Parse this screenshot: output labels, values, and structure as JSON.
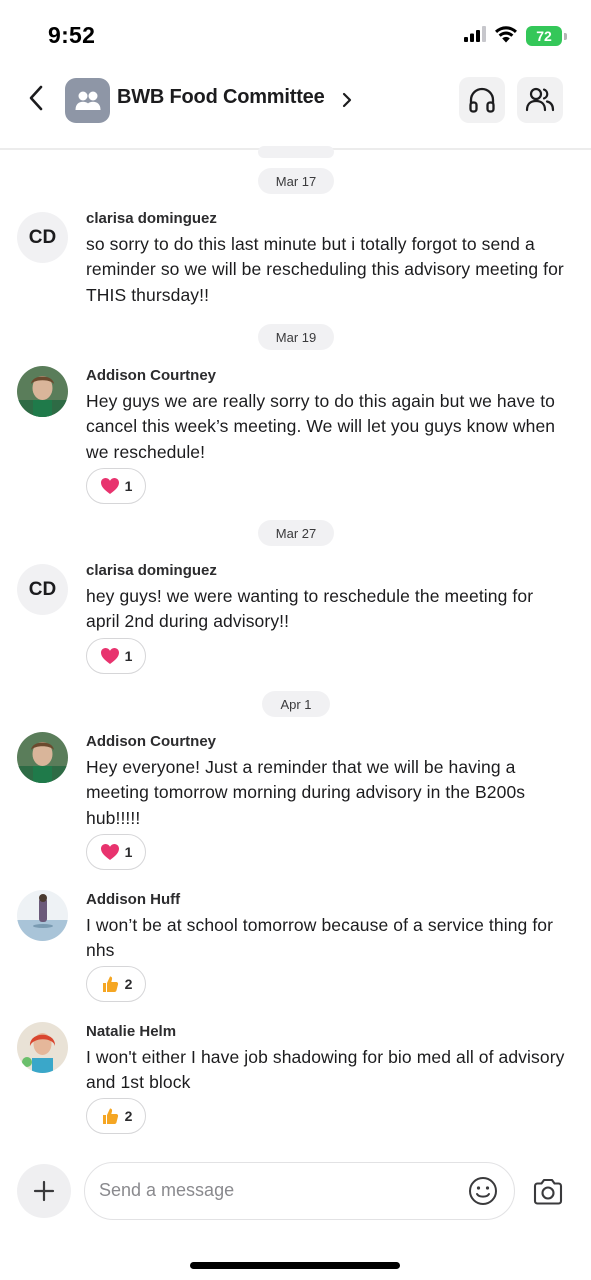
{
  "status_bar": {
    "time": "9:52",
    "battery": "72"
  },
  "header": {
    "group_name": "BWB Food Committee"
  },
  "messages": [
    {
      "type": "date",
      "label": "Mar 17"
    },
    {
      "type": "message",
      "sender": "clarisa dominguez",
      "avatar_initials": "CD",
      "text": "so sorry to do this last minute but i totally forgot to send a reminder so we will be rescheduling this advisory meeting for THIS thursday!!"
    },
    {
      "type": "date",
      "label": "Mar 19"
    },
    {
      "type": "message",
      "sender": "Addison Courtney",
      "text": "Hey guys we are really sorry to do this again but we have to cancel this week’s meeting. We will let you guys know when we reschedule!",
      "reaction": {
        "emoji": "heart-icon",
        "count": "1"
      }
    },
    {
      "type": "date",
      "label": "Mar 27"
    },
    {
      "type": "message",
      "sender": "clarisa dominguez",
      "avatar_initials": "CD",
      "text": "hey guys! we were wanting to reschedule the meeting for april 2nd during advisory!!",
      "reaction": {
        "emoji": "heart-icon",
        "count": "1"
      }
    },
    {
      "type": "date",
      "label": "Apr 1"
    },
    {
      "type": "message",
      "sender": "Addison Courtney",
      "text": "Hey everyone! Just a reminder that we will be having a meeting tomorrow morning during advisory in the B200s hub!!!!!",
      "reaction": {
        "emoji": "heart-icon",
        "count": "1"
      }
    },
    {
      "type": "message",
      "sender": "Addison Huff",
      "text": "I won’t be at school tomorrow because of a service thing for nhs",
      "reaction": {
        "emoji": "thumbs-up-icon",
        "count": "2"
      }
    },
    {
      "type": "message",
      "sender": "Natalie Helm",
      "text": "I won't either I have job shadowing for bio med all of advisory and 1st block",
      "reaction": {
        "emoji": "thumbs-up-icon",
        "count": "2"
      }
    }
  ],
  "composer": {
    "placeholder": "Send a message"
  },
  "colors": {
    "battery": "#34c759",
    "heart": "#e8336e",
    "thumbs_up": "#f5a623",
    "avatar_gray": "#8e96a6"
  }
}
